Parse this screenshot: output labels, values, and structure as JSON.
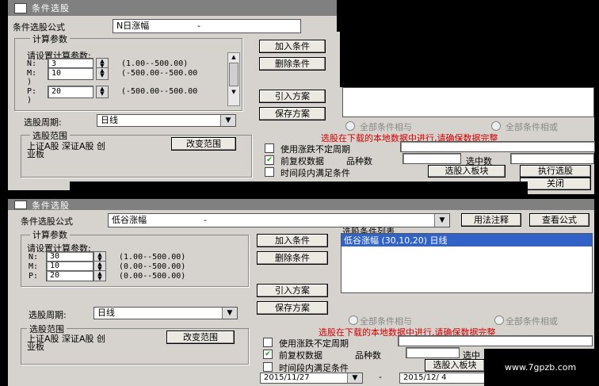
{
  "colors": {
    "accent": "#3062c8",
    "warning": "#d00000"
  },
  "top_window": {
    "title": "条件选股",
    "formula_label": "条件选股公式",
    "formula_value": "N日涨幅",
    "formula_value_suffix": "-",
    "params_group": "计算参数",
    "params_hint": "请设置计算参数:",
    "params": [
      {
        "name": "N:",
        "value": "3",
        "range": "(1.00--500.00)"
      },
      {
        "name": "M:",
        "value": "10",
        "range": "(-500.00--500.00"
      },
      {
        "name": "P:",
        "value": "20",
        "range": "(-500.00--500.00"
      }
    ],
    "param_wrap": ")",
    "period_label": "选股周期:",
    "period_value": "日线",
    "range_group": "选股范围",
    "range_text_1": "上证A股 深证A股 创",
    "range_text_2": "业板",
    "change_range_btn": "改变范围",
    "add_btn": "加入条件",
    "delete_btn": "删除条件",
    "import_btn": "引入方案",
    "save_btn": "保存方案",
    "radio_all_and": "全部条件相与",
    "radio_all_or": "全部条件相或",
    "warning": "选股在下载的本地数据中进行,请确保数据完整",
    "use_unstable": "使用涨跌不定周期",
    "pre_adjust": "前复权数据",
    "variety_count_label": "品种数",
    "selected_count_label": "选中数",
    "time_range": "时间段内满足条件",
    "to_block_btn": "选股入板块",
    "execute_btn": "执行选股",
    "close_btn": "关闭"
  },
  "bottom_window": {
    "title": "条件选股",
    "formula_label": "条件选股公式",
    "formula_value": "低谷涨幅",
    "formula_value_suffix": "-",
    "usage_btn": "用法注释",
    "view_formula_btn": "查看公式",
    "params_group": "计算参数",
    "params_hint": "请设置计算参数:",
    "params": [
      {
        "name": "N:",
        "value": "30",
        "range": "(1.00--500.00)"
      },
      {
        "name": "M:",
        "value": "10",
        "range": "(0.00--500.00)"
      },
      {
        "name": "P:",
        "value": "20",
        "range": "(0.00--500.00)"
      }
    ],
    "add_btn": "加入条件",
    "delete_btn": "删除条件",
    "import_btn": "引入方案",
    "save_btn": "保存方案",
    "list_label": "选股条件列表",
    "list_items": [
      "低谷涨幅 (30,10,20) 日线"
    ],
    "period_label": "选股周期:",
    "period_value": "日线",
    "radio_all_and": "全部条件相与",
    "radio_all_or": "全部条件相或",
    "range_group": "选股范围",
    "range_text_1": "上证A股 深证A股 创",
    "range_text_2": "业板",
    "change_range_btn": "改变范围",
    "warning": "选股在下载的本地数据中进行,请确保数据完整",
    "use_unstable": "使用涨跌不定周期",
    "pre_adjust": "前复权数据",
    "variety_count_label": "品种数",
    "selected_count_label": "选中",
    "time_range": "时间段内满足条件",
    "to_block_btn": "选股入板块",
    "date_from": "2015/11/27",
    "date_sep": "-",
    "date_to": "2015/12/ 4"
  },
  "watermark": "www.7gpzb.com"
}
